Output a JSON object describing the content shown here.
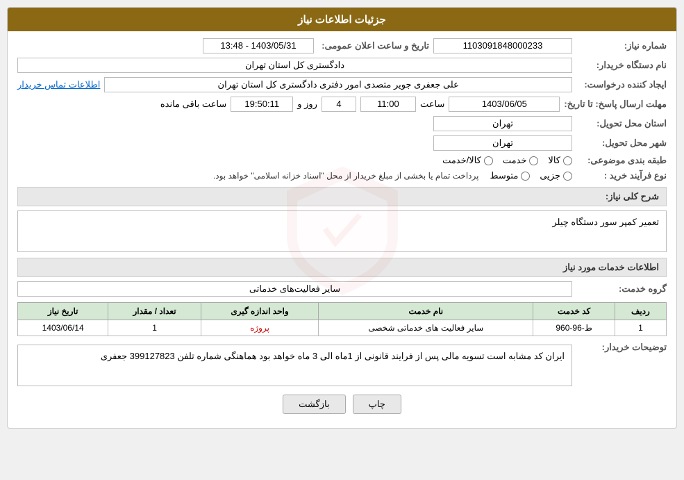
{
  "header": {
    "title": "جزئیات اطلاعات نیاز"
  },
  "fields": {
    "need_number_label": "شماره نیاز:",
    "need_number_value": "1103091848000233",
    "buyer_org_label": "نام دستگاه خریدار:",
    "buyer_org_value": "دادگستری کل استان تهران",
    "creator_label": "ایجاد کننده درخواست:",
    "creator_value": "علی جعفری جویر متصدی امور دفتری دادگستری کل استان تهران",
    "creator_link": "اطلاعات تماس خریدار",
    "send_deadline_label": "مهلت ارسال پاسخ: تا تاریخ:",
    "send_date": "1403/06/05",
    "send_time_label": "ساعت",
    "send_time": "11:00",
    "send_days_label": "روز و",
    "send_days": "4",
    "send_countdown": "19:50:11",
    "send_remaining_label": "ساعت باقی مانده",
    "announce_label": "تاریخ و ساعت اعلان عمومی:",
    "announce_value": "1403/05/31 - 13:48",
    "delivery_province_label": "استان محل تحویل:",
    "delivery_province_value": "تهران",
    "delivery_city_label": "شهر محل تحویل:",
    "delivery_city_value": "تهران",
    "category_label": "طبقه بندی موضوعی:",
    "category_options": [
      {
        "label": "کالا",
        "name": "category",
        "value": "kala"
      },
      {
        "label": "خدمت",
        "name": "category",
        "value": "khadamat"
      },
      {
        "label": "کالا/خدمت",
        "name": "category",
        "value": "kala_khadamat"
      }
    ],
    "purchase_type_label": "نوع فرآیند خرید :",
    "purchase_type_options": [
      {
        "label": "جزیی",
        "name": "purchase",
        "value": "jozii"
      },
      {
        "label": "متوسط",
        "name": "purchase",
        "value": "motavaset"
      }
    ],
    "purchase_note": "پرداخت تمام یا بخشی از مبلغ خریدار از محل \"اسناد خزانه اسلامی\" خواهد بود.",
    "need_description_label": "شرح کلی نیاز:",
    "need_description_value": "تعمیر کمپر سور دستگاه چیلر",
    "services_section_label": "اطلاعات خدمات مورد نیاز",
    "service_group_label": "گروه خدمت:",
    "service_group_value": "سایر فعالیت‌های خدماتی"
  },
  "table": {
    "headers": [
      "ردیف",
      "کد خدمت",
      "نام خدمت",
      "واحد اندازه گیری",
      "تعداد / مقدار",
      "تاریخ نیاز"
    ],
    "rows": [
      {
        "row": "1",
        "code": "ط-96-960",
        "name": "سایر فعالیت های خدماتی شخصی",
        "unit": "پروژه",
        "quantity": "1",
        "date": "1403/06/14"
      }
    ]
  },
  "buyer_description": {
    "label": "توضیحات خریدار:",
    "text": "ایران کد مشابه است تسویه مالی پس از فرایند قانونی از 1ماه الی 3 ماه خواهد بود هماهنگی شماره تلفن 399127823 جعفری"
  },
  "buttons": {
    "print": "چاپ",
    "back": "بازگشت"
  }
}
